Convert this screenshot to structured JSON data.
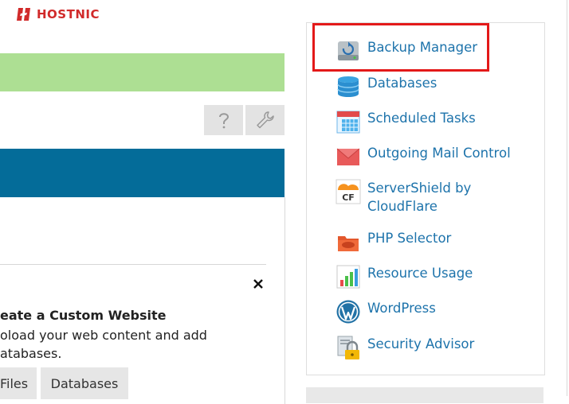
{
  "brand": {
    "name": "HOSTNIC",
    "color": "#d12a2a"
  },
  "colors": {
    "green_bar": "#addf93",
    "blue_bar": "#046c99",
    "link": "#1d73ab",
    "highlight": "#e31919"
  },
  "toolbar": {
    "help_icon": "help-icon",
    "settings_icon": "wrench-icon"
  },
  "panel": {
    "heading": "eate a Custom Website",
    "text_line1": "oload your web content and add",
    "text_line2": "atabases.",
    "tabs": [
      "Files",
      "Databases"
    ]
  },
  "tools": [
    {
      "label": "Backup Manager",
      "icon": "backup-manager-icon"
    },
    {
      "label": "Databases",
      "icon": "databases-icon"
    },
    {
      "label": "Scheduled Tasks",
      "icon": "calendar-icon"
    },
    {
      "label": "Outgoing Mail Control",
      "icon": "mail-icon"
    },
    {
      "label": "ServerShield by CloudFlare",
      "icon": "cloudflare-icon"
    },
    {
      "label": "PHP Selector",
      "icon": "php-icon"
    },
    {
      "label": "Resource Usage",
      "icon": "chart-icon"
    },
    {
      "label": "WordPress",
      "icon": "wordpress-icon"
    },
    {
      "label": "Security Advisor",
      "icon": "lock-icon"
    }
  ]
}
